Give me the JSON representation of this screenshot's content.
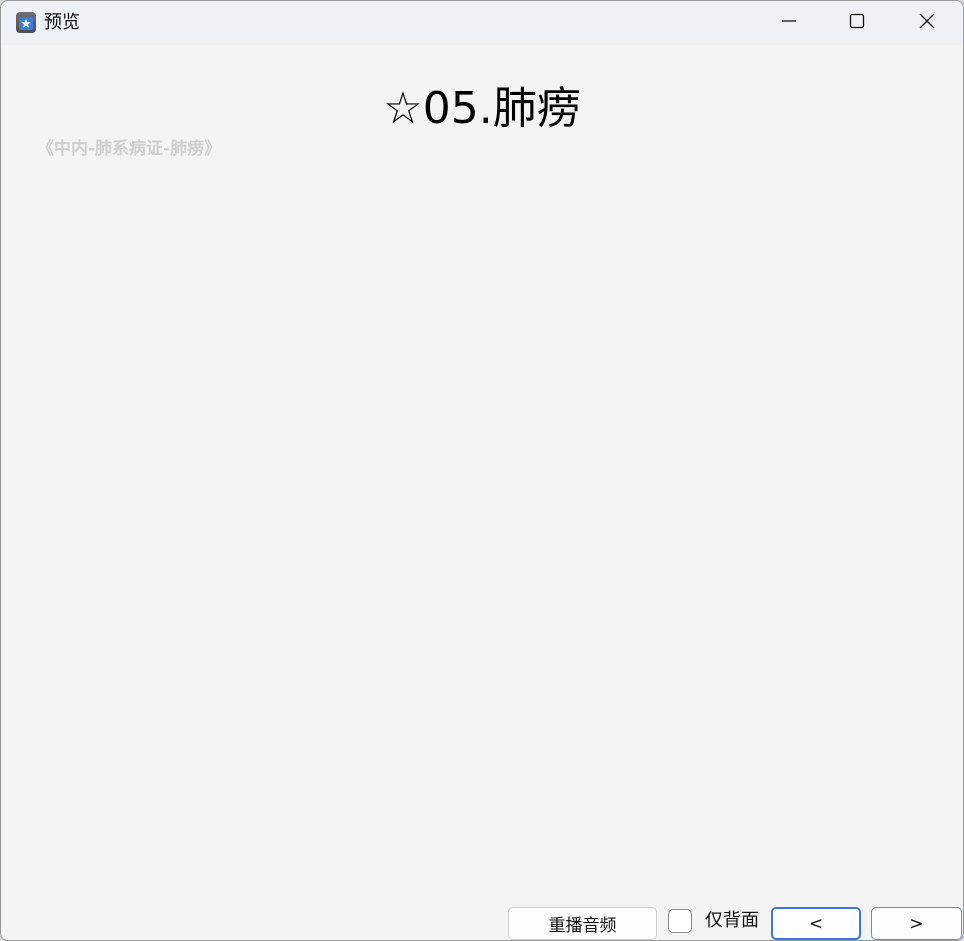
{
  "window": {
    "title": "预览",
    "controls": {
      "minimize_icon": "minimize-icon",
      "maximize_icon": "maximize-icon",
      "close_icon": "close-icon"
    }
  },
  "card": {
    "title": "☆05.肺痨",
    "deck_path": "《中内-肺系病证-肺痨》"
  },
  "toolbar": {
    "replay_audio_label": "重播音频",
    "back_only_label": "仅背面",
    "back_only_checked": false,
    "prev_label": "<",
    "next_label": ">"
  },
  "colors": {
    "accent": "#3b78d8",
    "background": "#f4f4f4",
    "titlebar": "#eef2f7",
    "deck_path_text": "#cfcfcf"
  }
}
